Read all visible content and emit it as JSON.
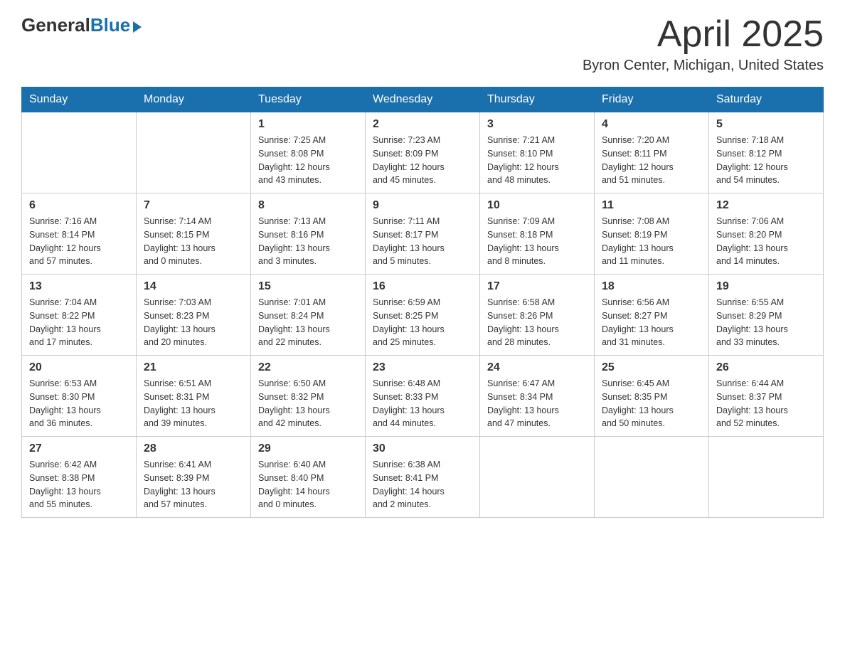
{
  "logo": {
    "general": "General",
    "blue": "Blue"
  },
  "title": {
    "month": "April 2025",
    "location": "Byron Center, Michigan, United States"
  },
  "weekdays": [
    "Sunday",
    "Monday",
    "Tuesday",
    "Wednesday",
    "Thursday",
    "Friday",
    "Saturday"
  ],
  "weeks": [
    [
      {
        "day": "",
        "info": ""
      },
      {
        "day": "",
        "info": ""
      },
      {
        "day": "1",
        "info": "Sunrise: 7:25 AM\nSunset: 8:08 PM\nDaylight: 12 hours\nand 43 minutes."
      },
      {
        "day": "2",
        "info": "Sunrise: 7:23 AM\nSunset: 8:09 PM\nDaylight: 12 hours\nand 45 minutes."
      },
      {
        "day": "3",
        "info": "Sunrise: 7:21 AM\nSunset: 8:10 PM\nDaylight: 12 hours\nand 48 minutes."
      },
      {
        "day": "4",
        "info": "Sunrise: 7:20 AM\nSunset: 8:11 PM\nDaylight: 12 hours\nand 51 minutes."
      },
      {
        "day": "5",
        "info": "Sunrise: 7:18 AM\nSunset: 8:12 PM\nDaylight: 12 hours\nand 54 minutes."
      }
    ],
    [
      {
        "day": "6",
        "info": "Sunrise: 7:16 AM\nSunset: 8:14 PM\nDaylight: 12 hours\nand 57 minutes."
      },
      {
        "day": "7",
        "info": "Sunrise: 7:14 AM\nSunset: 8:15 PM\nDaylight: 13 hours\nand 0 minutes."
      },
      {
        "day": "8",
        "info": "Sunrise: 7:13 AM\nSunset: 8:16 PM\nDaylight: 13 hours\nand 3 minutes."
      },
      {
        "day": "9",
        "info": "Sunrise: 7:11 AM\nSunset: 8:17 PM\nDaylight: 13 hours\nand 5 minutes."
      },
      {
        "day": "10",
        "info": "Sunrise: 7:09 AM\nSunset: 8:18 PM\nDaylight: 13 hours\nand 8 minutes."
      },
      {
        "day": "11",
        "info": "Sunrise: 7:08 AM\nSunset: 8:19 PM\nDaylight: 13 hours\nand 11 minutes."
      },
      {
        "day": "12",
        "info": "Sunrise: 7:06 AM\nSunset: 8:20 PM\nDaylight: 13 hours\nand 14 minutes."
      }
    ],
    [
      {
        "day": "13",
        "info": "Sunrise: 7:04 AM\nSunset: 8:22 PM\nDaylight: 13 hours\nand 17 minutes."
      },
      {
        "day": "14",
        "info": "Sunrise: 7:03 AM\nSunset: 8:23 PM\nDaylight: 13 hours\nand 20 minutes."
      },
      {
        "day": "15",
        "info": "Sunrise: 7:01 AM\nSunset: 8:24 PM\nDaylight: 13 hours\nand 22 minutes."
      },
      {
        "day": "16",
        "info": "Sunrise: 6:59 AM\nSunset: 8:25 PM\nDaylight: 13 hours\nand 25 minutes."
      },
      {
        "day": "17",
        "info": "Sunrise: 6:58 AM\nSunset: 8:26 PM\nDaylight: 13 hours\nand 28 minutes."
      },
      {
        "day": "18",
        "info": "Sunrise: 6:56 AM\nSunset: 8:27 PM\nDaylight: 13 hours\nand 31 minutes."
      },
      {
        "day": "19",
        "info": "Sunrise: 6:55 AM\nSunset: 8:29 PM\nDaylight: 13 hours\nand 33 minutes."
      }
    ],
    [
      {
        "day": "20",
        "info": "Sunrise: 6:53 AM\nSunset: 8:30 PM\nDaylight: 13 hours\nand 36 minutes."
      },
      {
        "day": "21",
        "info": "Sunrise: 6:51 AM\nSunset: 8:31 PM\nDaylight: 13 hours\nand 39 minutes."
      },
      {
        "day": "22",
        "info": "Sunrise: 6:50 AM\nSunset: 8:32 PM\nDaylight: 13 hours\nand 42 minutes."
      },
      {
        "day": "23",
        "info": "Sunrise: 6:48 AM\nSunset: 8:33 PM\nDaylight: 13 hours\nand 44 minutes."
      },
      {
        "day": "24",
        "info": "Sunrise: 6:47 AM\nSunset: 8:34 PM\nDaylight: 13 hours\nand 47 minutes."
      },
      {
        "day": "25",
        "info": "Sunrise: 6:45 AM\nSunset: 8:35 PM\nDaylight: 13 hours\nand 50 minutes."
      },
      {
        "day": "26",
        "info": "Sunrise: 6:44 AM\nSunset: 8:37 PM\nDaylight: 13 hours\nand 52 minutes."
      }
    ],
    [
      {
        "day": "27",
        "info": "Sunrise: 6:42 AM\nSunset: 8:38 PM\nDaylight: 13 hours\nand 55 minutes."
      },
      {
        "day": "28",
        "info": "Sunrise: 6:41 AM\nSunset: 8:39 PM\nDaylight: 13 hours\nand 57 minutes."
      },
      {
        "day": "29",
        "info": "Sunrise: 6:40 AM\nSunset: 8:40 PM\nDaylight: 14 hours\nand 0 minutes."
      },
      {
        "day": "30",
        "info": "Sunrise: 6:38 AM\nSunset: 8:41 PM\nDaylight: 14 hours\nand 2 minutes."
      },
      {
        "day": "",
        "info": ""
      },
      {
        "day": "",
        "info": ""
      },
      {
        "day": "",
        "info": ""
      }
    ]
  ]
}
